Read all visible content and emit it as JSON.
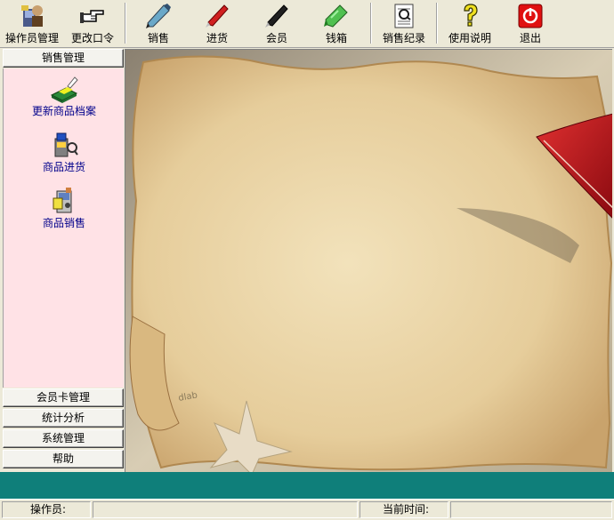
{
  "toolbar": {
    "items": [
      {
        "label": "操作员管理",
        "icon": "operator-icon"
      },
      {
        "label": "更改口令",
        "icon": "pointing-hand-icon"
      },
      {
        "label": "销售",
        "icon": "blue-pen-icon"
      },
      {
        "label": "进货",
        "icon": "red-pen-icon"
      },
      {
        "label": "会员",
        "icon": "black-pen-icon"
      },
      {
        "label": "钱箱",
        "icon": "green-highlighter-icon"
      },
      {
        "label": "销售纪录",
        "icon": "document-magnifier-icon"
      },
      {
        "label": "使用说明",
        "icon": "question-mark-icon"
      },
      {
        "label": "退出",
        "icon": "power-icon"
      }
    ]
  },
  "sidebar": {
    "groups": [
      {
        "label": "销售管理"
      },
      {
        "label": "会员卡管理"
      },
      {
        "label": "统计分析"
      },
      {
        "label": "系统管理"
      },
      {
        "label": "帮助"
      }
    ],
    "sales_items": [
      {
        "label": "更新商品档案",
        "icon": "product-file-icon"
      },
      {
        "label": "商品进货",
        "icon": "goods-receipt-icon"
      },
      {
        "label": "商品销售",
        "icon": "sales-register-icon"
      }
    ]
  },
  "main": {
    "watermark": "dlab"
  },
  "statusbar": {
    "operator_label": "操作员:",
    "operator_value": "",
    "time_label": "当前时间:",
    "time_value": ""
  },
  "colors": {
    "face": "#ece9d8",
    "sales_panel": "#ffe2e6",
    "teal_strip": "#0f7f7a",
    "item_text": "#00008b"
  }
}
